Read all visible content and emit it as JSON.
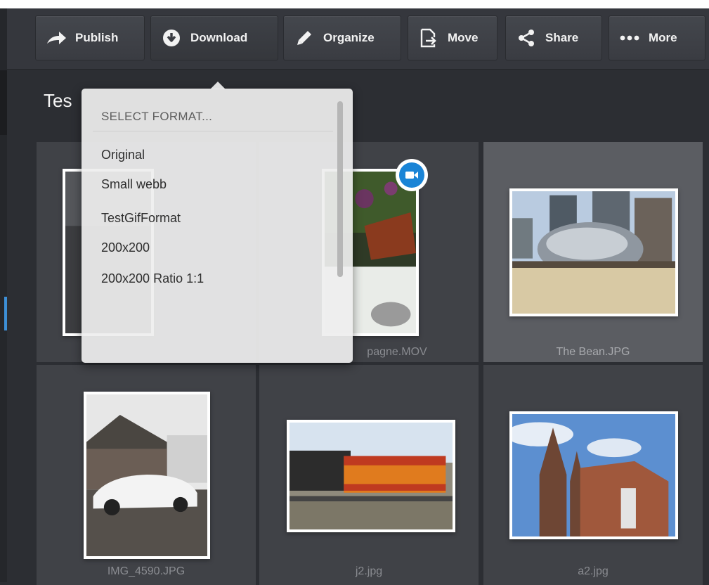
{
  "toolbar": {
    "buttons": [
      {
        "label": "Publish",
        "icon": "publish-arrow-icon"
      },
      {
        "label": "Download",
        "icon": "download-icon"
      },
      {
        "label": "Organize",
        "icon": "pencil-icon"
      },
      {
        "label": "Move",
        "icon": "move-icon"
      },
      {
        "label": "Share",
        "icon": "share-icon"
      },
      {
        "label": "More",
        "icon": "more-dots-icon"
      }
    ]
  },
  "folder": {
    "title_visible": "Tes"
  },
  "download_menu": {
    "header": "SELECT FORMAT...",
    "options": [
      "Original",
      "Small webb",
      "TestGifFormat",
      "200x200",
      "200x200 Ratio 1:1"
    ]
  },
  "files": [
    {
      "name": "",
      "type": "image"
    },
    {
      "name": "pagne.MOV",
      "type": "video"
    },
    {
      "name": "The Bean.JPG",
      "type": "image",
      "selected": true
    },
    {
      "name": "IMG_4590.JPG",
      "type": "image"
    },
    {
      "name": "j2.jpg",
      "type": "image"
    },
    {
      "name": "a2.jpg",
      "type": "image"
    }
  ],
  "colors": {
    "background": "#2c2e33",
    "toolbar": "#35373d",
    "tile": "#404247",
    "tile_selected": "#5b5d62",
    "accent": "#1a84d6"
  }
}
